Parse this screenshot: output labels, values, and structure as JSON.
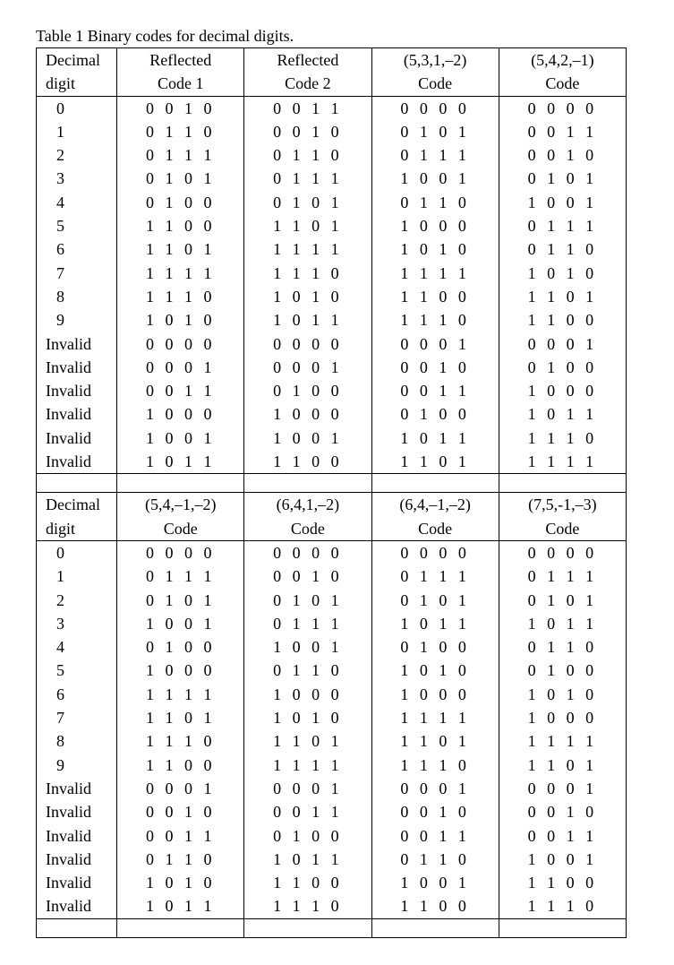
{
  "caption": "Table 1  Binary codes for decimal digits.",
  "columns_digit_header": [
    "Decimal",
    "digit"
  ],
  "sections": [
    {
      "code_headers": [
        [
          "Reflected",
          "Code 1"
        ],
        [
          "Reflected",
          "Code 2"
        ],
        [
          "(5,3,1,–2)",
          "Code"
        ],
        [
          "(5,4,2,–1)",
          "Code"
        ]
      ],
      "rows": [
        {
          "digit": "0",
          "codes": [
            "0 0 1 0",
            "0 0 1 1",
            "0 0 0 0",
            "0 0 0 0"
          ]
        },
        {
          "digit": "1",
          "codes": [
            "0 1 1 0",
            "0 0 1 0",
            "0 1 0 1",
            "0 0 1 1"
          ]
        },
        {
          "digit": "2",
          "codes": [
            "0 1 1 1",
            "0 1 1 0",
            "0 1 1 1",
            "0 0 1 0"
          ]
        },
        {
          "digit": "3",
          "codes": [
            "0 1 0 1",
            "0 1 1 1",
            "1 0 0 1",
            "0 1 0 1"
          ]
        },
        {
          "digit": "4",
          "codes": [
            "0 1 0 0",
            "0 1 0 1",
            "0 1 1 0",
            "1 0 0 1"
          ]
        },
        {
          "digit": "5",
          "codes": [
            "1 1 0 0",
            "1 1 0 1",
            "1 0 0 0",
            "0 1 1 1"
          ]
        },
        {
          "digit": "6",
          "codes": [
            "1 1 0 1",
            "1 1 1 1",
            "1 0 1 0",
            "0 1 1 0"
          ]
        },
        {
          "digit": "7",
          "codes": [
            "1 1 1 1",
            "1 1 1 0",
            "1 1 1 1",
            "1 0 1 0"
          ]
        },
        {
          "digit": "8",
          "codes": [
            "1 1 1 0",
            "1 0 1 0",
            "1 1 0 0",
            "1 1 0 1"
          ]
        },
        {
          "digit": "9",
          "codes": [
            "1 0 1 0",
            "1 0 1 1",
            "1 1 1 0",
            "1 1 0 0"
          ]
        },
        {
          "digit": "Invalid",
          "codes": [
            "0 0 0 0",
            "0 0 0 0",
            "0 0 0 1",
            "0 0 0 1"
          ]
        },
        {
          "digit": "Invalid",
          "codes": [
            "0 0 0 1",
            "0 0 0 1",
            "0 0 1 0",
            "0 1 0 0"
          ]
        },
        {
          "digit": "Invalid",
          "codes": [
            "0 0 1 1",
            "0 1 0 0",
            "0 0 1 1",
            "1 0 0 0"
          ]
        },
        {
          "digit": "Invalid",
          "codes": [
            "1 0 0 0",
            "1 0 0 0",
            "0 1 0 0",
            "1 0 1 1"
          ]
        },
        {
          "digit": "Invalid",
          "codes": [
            "1 0 0 1",
            "1 0 0 1",
            "1 0 1 1",
            "1 1 1 0"
          ]
        },
        {
          "digit": "Invalid",
          "codes": [
            "1 0 1 1",
            "1 1 0 0",
            "1 1 0 1",
            "1 1 1 1"
          ]
        }
      ]
    },
    {
      "code_headers": [
        [
          "(5,4,–1,–2)",
          "Code"
        ],
        [
          "(6,4,1,–2)",
          "Code"
        ],
        [
          "(6,4,–1,–2)",
          "Code"
        ],
        [
          "(7,5,-1,–3)",
          "Code"
        ]
      ],
      "rows": [
        {
          "digit": "0",
          "codes": [
            "0 0 0 0",
            "0 0 0 0",
            "0 0 0 0",
            "0 0 0 0"
          ]
        },
        {
          "digit": "1",
          "codes": [
            "0 1 1 1",
            "0 0 1 0",
            "0 1 1 1",
            "0 1 1 1"
          ]
        },
        {
          "digit": "2",
          "codes": [
            "0 1 0 1",
            "0 1 0 1",
            "0 1 0 1",
            "0 1 0 1"
          ]
        },
        {
          "digit": "3",
          "codes": [
            "1 0 0 1",
            "0 1 1 1",
            "1 0 1 1",
            "1 0 1 1"
          ]
        },
        {
          "digit": "4",
          "codes": [
            "0 1 0 0",
            "1 0 0 1",
            "0 1 0 0",
            "0 1 1 0"
          ]
        },
        {
          "digit": "5",
          "codes": [
            "1 0 0 0",
            "0 1 1 0",
            "1 0 1 0",
            "0 1 0 0"
          ]
        },
        {
          "digit": "6",
          "codes": [
            "1 1 1 1",
            "1 0 0 0",
            "1 0 0 0",
            "1 0 1 0"
          ]
        },
        {
          "digit": "7",
          "codes": [
            "1 1 0 1",
            "1 0 1 0",
            "1 1 1 1",
            "1 0 0 0"
          ]
        },
        {
          "digit": "8",
          "codes": [
            "1 1 1 0",
            "1 1 0 1",
            "1 1 0 1",
            "1 1 1 1"
          ]
        },
        {
          "digit": "9",
          "codes": [
            "1 1 0 0",
            "1 1 1 1",
            "1 1 1 0",
            "1 1 0 1"
          ]
        },
        {
          "digit": "Invalid",
          "codes": [
            "0 0 0 1",
            "0 0 0 1",
            "0 0 0 1",
            "0 0 0 1"
          ]
        },
        {
          "digit": "Invalid",
          "codes": [
            "0 0 1 0",
            "0 0 1 1",
            "0 0 1 0",
            "0 0 1 0"
          ]
        },
        {
          "digit": "Invalid",
          "codes": [
            "0 0 1 1",
            "0 1 0 0",
            "0 0 1 1",
            "0 0 1 1"
          ]
        },
        {
          "digit": "Invalid",
          "codes": [
            "0 1 1 0",
            "1 0 1 1",
            "0 1 1 0",
            "1 0 0 1"
          ]
        },
        {
          "digit": "Invalid",
          "codes": [
            "1 0 1 0",
            "1 1 0 0",
            "1 0 0 1",
            "1 1 0 0"
          ]
        },
        {
          "digit": "Invalid",
          "codes": [
            "1 0 1 1",
            "1 1 1 0",
            "1 1 0 0",
            "1 1 1 0"
          ]
        }
      ]
    }
  ]
}
